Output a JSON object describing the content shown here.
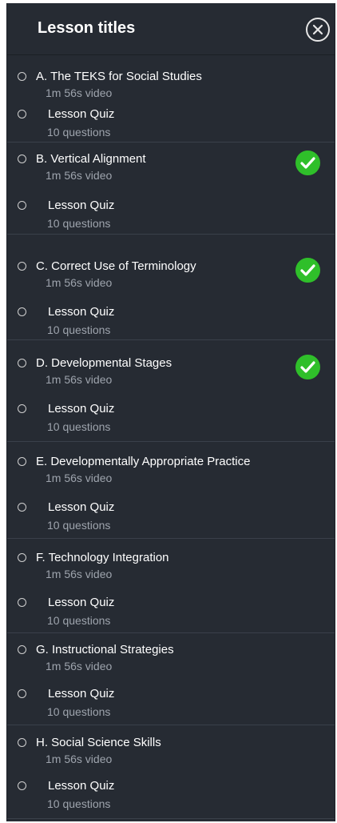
{
  "header": {
    "title": "Lesson titles"
  },
  "lessons": [
    {
      "title": "A. The TEKS for Social Studies",
      "sub": "1m 56s video",
      "completed": false,
      "quiz": {
        "title": "Lesson Quiz",
        "sub": "10 questions"
      }
    },
    {
      "title": "B. Vertical Alignment",
      "sub": "1m 56s video",
      "completed": true,
      "quiz": {
        "title": "Lesson Quiz",
        "sub": "10 questions"
      }
    },
    {
      "title": "C. Correct Use of Terminology",
      "sub": "1m 56s video",
      "completed": true,
      "quiz": {
        "title": "Lesson Quiz",
        "sub": "10 questions"
      }
    },
    {
      "title": "D. Developmental Stages",
      "sub": "1m 56s video",
      "completed": true,
      "quiz": {
        "title": "Lesson Quiz",
        "sub": "10 questions"
      }
    },
    {
      "title": "E. Developmentally Appropriate Practice",
      "sub": "1m 56s video",
      "completed": false,
      "quiz": {
        "title": "Lesson Quiz",
        "sub": "10 questions"
      }
    },
    {
      "title": "F. Technology Integration",
      "sub": "1m 56s video",
      "completed": false,
      "quiz": {
        "title": "Lesson Quiz",
        "sub": "10 questions"
      }
    },
    {
      "title": "G. Instructional Strategies",
      "sub": "1m 56s video",
      "completed": false,
      "quiz": {
        "title": "Lesson Quiz",
        "sub": "10 questions"
      }
    },
    {
      "title": "H. Social Science Skills",
      "sub": "1m 56s video",
      "completed": false,
      "quiz": {
        "title": "Lesson Quiz",
        "sub": "10 questions"
      }
    }
  ],
  "colors": {
    "panel": "#262b33",
    "text": "#ffffff",
    "subtext": "#9ea4ad",
    "check": "#2fbf2a"
  },
  "icons": {
    "close": "close-icon",
    "radio": "radio-circle-icon",
    "completed": "check-circle-icon"
  }
}
